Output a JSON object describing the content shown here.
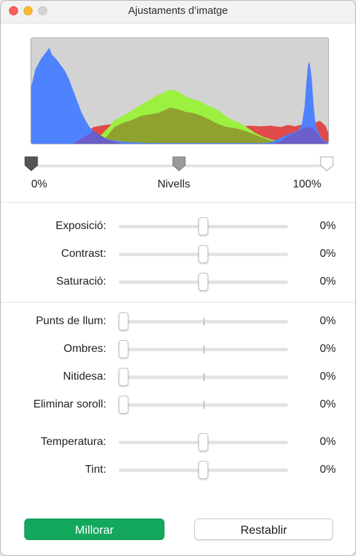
{
  "window": {
    "title": "Ajustaments d’imatge"
  },
  "levels": {
    "min_label": "0%",
    "mid_label": "Nivells",
    "max_label": "100%"
  },
  "adjustments": [
    {
      "label": "Exposició:",
      "value": "0%",
      "level": 0.5
    },
    {
      "label": "Contrast:",
      "value": "0%",
      "level": 0.5
    },
    {
      "label": "Saturació:",
      "value": "0%",
      "level": 0.5
    },
    {
      "label": "Punts de llum:",
      "value": "0%",
      "level": 0.0
    },
    {
      "label": "Ombres:",
      "value": "0%",
      "level": 0.0
    },
    {
      "label": "Nitidesa:",
      "value": "0%",
      "level": 0.0
    },
    {
      "label": "Eliminar soroll:",
      "value": "0%",
      "level": 0.0
    },
    {
      "label": "Temperatura:",
      "value": "0%",
      "level": 0.5
    },
    {
      "label": "Tint:",
      "value": "0%",
      "level": 0.5
    }
  ],
  "buttons": {
    "enhance": "Millorar",
    "reset": "Restablir"
  },
  "colors": {
    "enhance": "#13a85e",
    "red_channel": "#e04a4a",
    "green_channel": "#9cf040",
    "blue_channel": "#4f82ff"
  }
}
